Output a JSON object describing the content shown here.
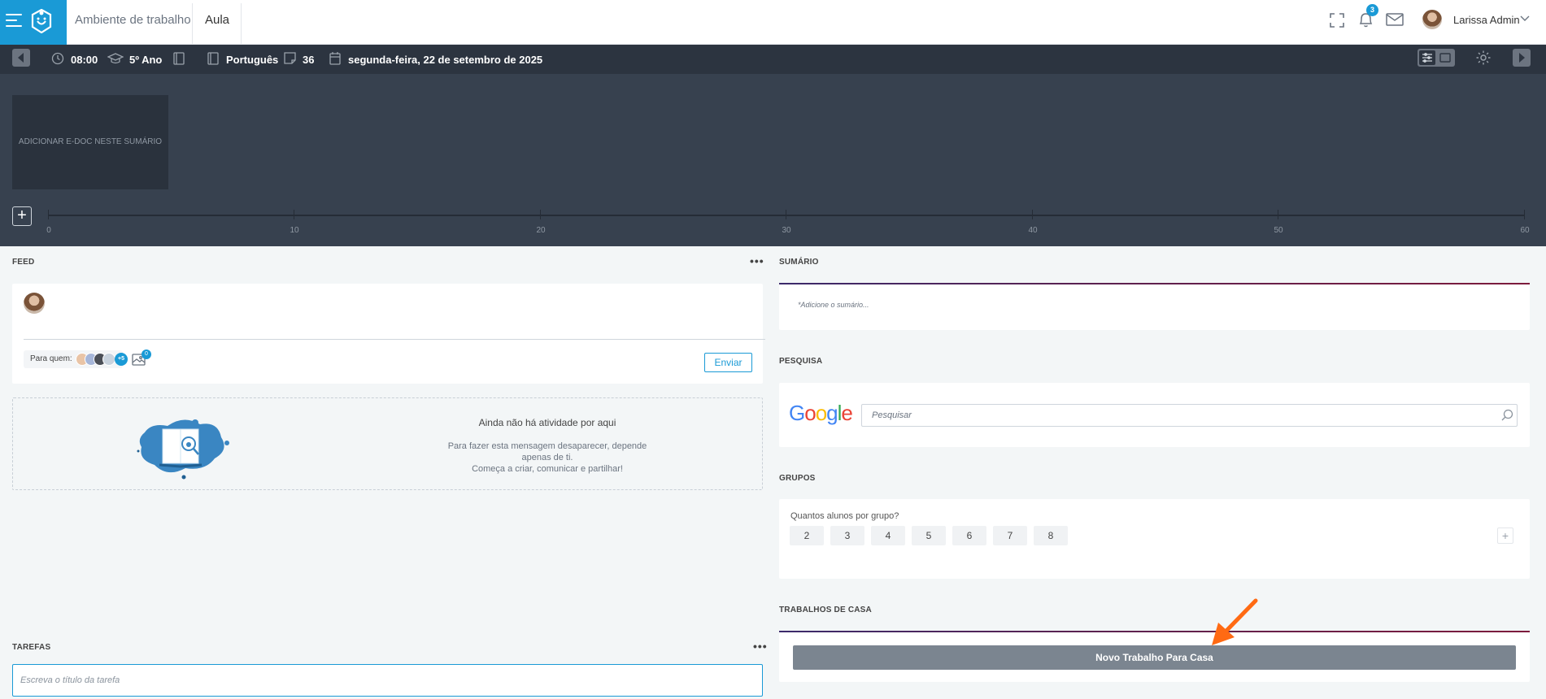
{
  "topbar": {
    "breadcrumb": [
      "Ambiente de trabalho",
      "Aula"
    ],
    "notifications_count": "3",
    "user_name": "Larissa Admin"
  },
  "toolbar": {
    "time": "08:00",
    "grade": "5º Ano",
    "subject": "Português",
    "lesson_number": "36",
    "date": "segunda-feira, 22 de setembro de 2025"
  },
  "timeline": {
    "edoc_label": "ADICIONAR E-DOC NESTE SUMÁRIO",
    "add_label": "+",
    "ticks": [
      "0",
      "10",
      "20",
      "30",
      "40",
      "50",
      "60"
    ]
  },
  "feed": {
    "title": "FEED",
    "more": "•••",
    "to_label": "Para quem:",
    "recipients_more": "+5",
    "attachments_count": "0",
    "send_label": "Enviar",
    "empty_title": "Ainda não há atividade por aqui",
    "empty_text": "Para fazer esta mensagem desaparecer, depende apenas de ti.\nComeça a criar, comunicar e partilhar!"
  },
  "tarefas": {
    "title": "TAREFAS",
    "more": "•••",
    "placeholder": "Escreva o título da tarefa"
  },
  "sumario": {
    "title": "SUMÁRIO",
    "placeholder": "*Adicione o sumário..."
  },
  "pesquisa": {
    "title": "PESQUISA",
    "placeholder": "Pesquisar"
  },
  "grupos": {
    "title": "GRUPOS",
    "question": "Quantos alunos por grupo?",
    "options": [
      "2",
      "3",
      "4",
      "5",
      "6",
      "7",
      "8"
    ],
    "add": "+"
  },
  "trabalhos": {
    "title": "TRABALHOS DE CASA",
    "new_label": "Novo Trabalho Para Casa"
  },
  "colors": {
    "accent": "#1a9ad6",
    "toolbar_bg": "#2c3440",
    "timeline_bg": "#37414f",
    "annotation_arrow": "#ff6a13"
  }
}
